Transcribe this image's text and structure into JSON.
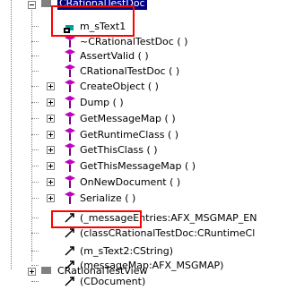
{
  "tree": {
    "top_item": "CRationalTestDoc",
    "items": [
      {
        "label": "m_sText1",
        "icon": "member-variable-icon"
      },
      {
        "label": "~CRationalTestDoc ( )",
        "icon": "member-function-icon"
      },
      {
        "label": "AssertValid ( )",
        "icon": "member-function-icon"
      },
      {
        "label": "CRationalTestDoc ( )",
        "icon": "member-function-icon"
      },
      {
        "label": "CreateObject ( )",
        "icon": "member-function-icon"
      },
      {
        "label": "Dump ( )",
        "icon": "member-function-icon"
      },
      {
        "label": "GetMessageMap ( )",
        "icon": "member-function-icon"
      },
      {
        "label": "GetRuntimeClass ( )",
        "icon": "member-function-icon"
      },
      {
        "label": "GetThisClass ( )",
        "icon": "member-function-icon"
      },
      {
        "label": "GetThisMessageMap ( )",
        "icon": "member-function-icon"
      },
      {
        "label": "OnNewDocument ( )",
        "icon": "member-function-icon"
      },
      {
        "label": "Serialize ( )",
        "icon": "member-function-icon"
      },
      {
        "label": "(_messageEntries:AFX_MSGMAP_EN",
        "icon": "reference-arrow-icon"
      },
      {
        "label": "(classCRationalTestDoc:CRuntimeCl",
        "icon": "reference-arrow-icon"
      },
      {
        "label": "(m_sText2:CString)",
        "icon": "reference-arrow-icon"
      },
      {
        "label": "(messageMap:AFX_MSGMAP)",
        "icon": "reference-arrow-icon"
      },
      {
        "label": "(CDocument)",
        "icon": "reference-arrow-icon"
      }
    ],
    "bottom_item": "CRationalTestView"
  },
  "colors": {
    "highlight": "#ff0000",
    "selection": "#000080",
    "method": "#c000c0",
    "field": "#00a0a0"
  }
}
